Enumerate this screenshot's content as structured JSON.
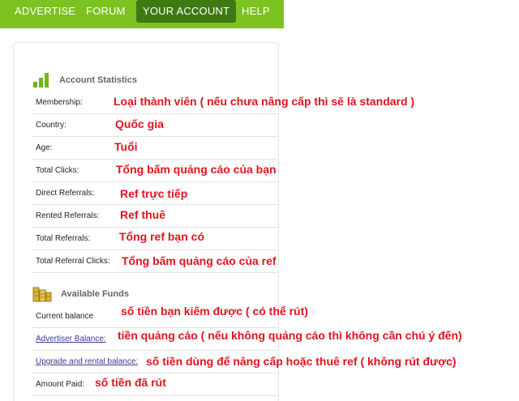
{
  "nav": {
    "items": [
      {
        "label": "ADVERTISE"
      },
      {
        "label": "FORUM"
      },
      {
        "label": "YOUR ACCOUNT"
      },
      {
        "label": "HELP"
      }
    ]
  },
  "stats": {
    "title": "Account Statistics",
    "icon": "bar-chart-icon",
    "rows": [
      {
        "label": "Membership:",
        "note": "Loại thành viên ( nếu chưa nâng cấp thì sẽ là standard )"
      },
      {
        "label": "Country:",
        "note": "Quốc gia"
      },
      {
        "label": "Age:",
        "note": "Tuổi"
      },
      {
        "label": "Total Clicks:",
        "note": "Tổng bấm quảng cáo của bạn"
      },
      {
        "label": "Direct Referrals:",
        "note": "Ref trực tiếp"
      },
      {
        "label": "Rented Referrals:",
        "note": "Ref thuê"
      },
      {
        "label": "Total Referrals:",
        "note": "Tổng ref bạn có"
      },
      {
        "label": "Total Referral Clicks:",
        "note": "Tổng bấm quảng cáo của ref"
      }
    ]
  },
  "funds": {
    "title": "Available Funds",
    "icon": "coins-icon",
    "rows": [
      {
        "label": "Current balance",
        "note": "số tiền bạn kiếm được ( có thể rút)"
      },
      {
        "label": "Advertiser Balance:",
        "note": "tiền quảng cáo ( nếu không quảng cáo thì không cần chú ý đến)"
      },
      {
        "label": "Upgrade and rental balance:",
        "note": "số tiền dùng để nâng cấp hoặc thuê ref ( không rút được)"
      },
      {
        "label": "Amount Paid:",
        "note": "số tiền đã rút"
      }
    ]
  },
  "colors": {
    "nav_bg": "#7cc220",
    "nav_active": "#3e7a12",
    "note_red": "#e0141e",
    "link": "#3b3b8f"
  }
}
